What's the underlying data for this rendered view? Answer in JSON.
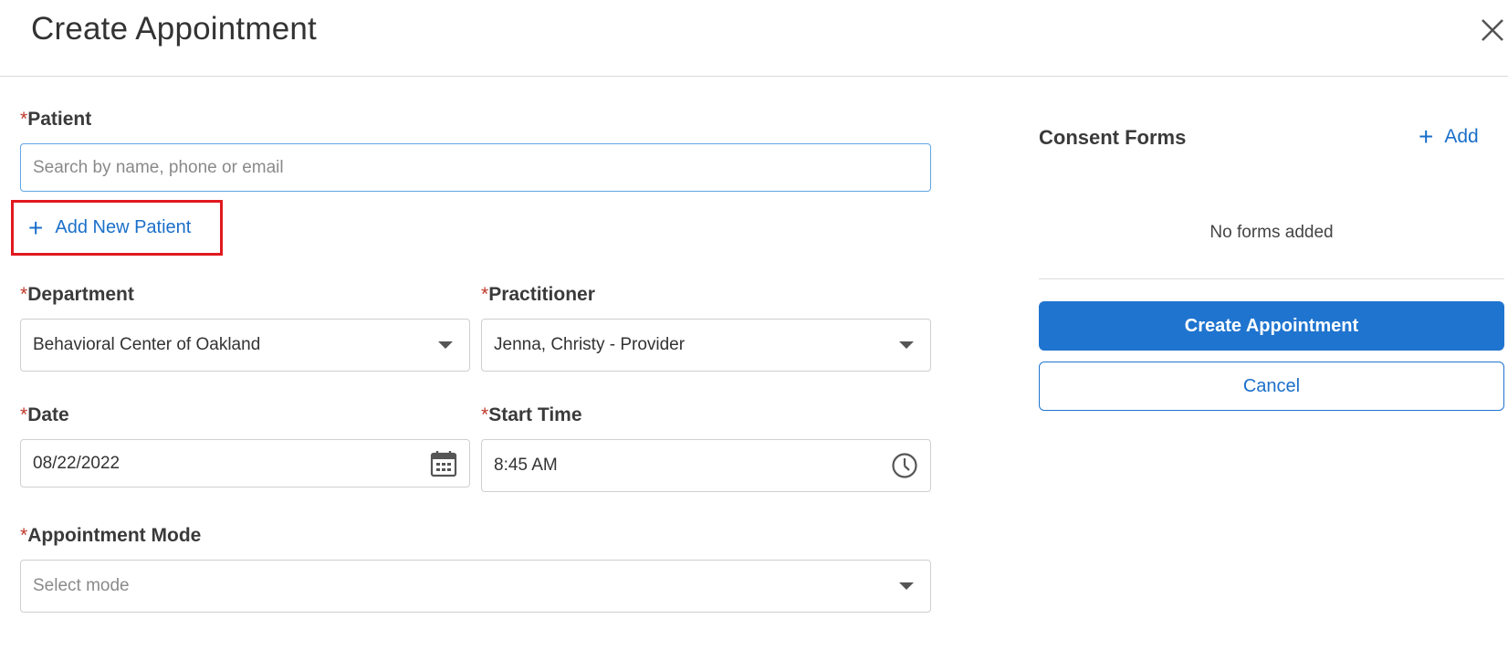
{
  "dialog": {
    "title": "Create Appointment"
  },
  "form": {
    "patient": {
      "label": "Patient",
      "required_mark": "*",
      "placeholder": "Search by name, phone or email",
      "value": ""
    },
    "add_new_patient": {
      "label": "Add New Patient",
      "highlighted": true,
      "highlight_color": "#e0191f"
    },
    "department": {
      "label": "Department",
      "required_mark": "*",
      "value": "Behavioral Center of Oakland"
    },
    "practitioner": {
      "label": "Practitioner",
      "required_mark": "*",
      "value": "Jenna, Christy - Provider"
    },
    "date": {
      "label": "Date",
      "required_mark": "*",
      "value": "08/22/2022"
    },
    "start_time": {
      "label": "Start Time",
      "required_mark": "*",
      "value": "8:45 AM"
    },
    "appointment_mode": {
      "label": "Appointment Mode",
      "required_mark": "*",
      "placeholder": "Select mode"
    }
  },
  "consent": {
    "heading": "Consent Forms",
    "add_label": "Add",
    "empty_text": "No forms added"
  },
  "actions": {
    "create_label": "Create Appointment",
    "cancel_label": "Cancel"
  },
  "colors": {
    "accent": "#1f74cf",
    "required": "#c0392b",
    "focus_border": "#5fa6e6"
  },
  "icons": {
    "close": "close-icon",
    "plus": "plus-icon",
    "calendar": "calendar-icon",
    "clock": "clock-icon",
    "dropdown": "chevron-down-icon"
  }
}
